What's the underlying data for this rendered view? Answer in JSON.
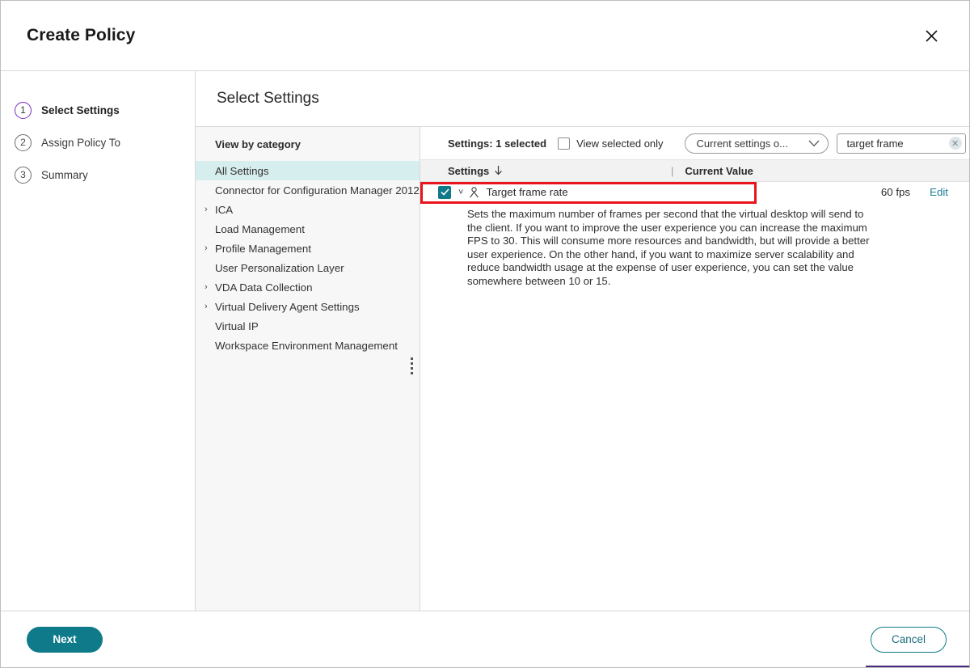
{
  "window": {
    "title": "Create Policy",
    "close_icon": "close-icon",
    "accent_teal": "#0f7b8a",
    "accent_purple": "#7b2fbe",
    "highlight_red": "#e8141e"
  },
  "steps": [
    {
      "num": "1",
      "label": "Select Settings",
      "active": true
    },
    {
      "num": "2",
      "label": "Assign Policy To",
      "active": false
    },
    {
      "num": "3",
      "label": "Summary",
      "active": false
    }
  ],
  "main": {
    "heading": "Select Settings"
  },
  "categories": {
    "title": "View by category",
    "items": [
      {
        "label": "All Settings",
        "expandable": false,
        "selected": true
      },
      {
        "label": "Connector for Configuration Manager 2012",
        "expandable": false,
        "selected": false
      },
      {
        "label": "ICA",
        "expandable": true,
        "selected": false
      },
      {
        "label": "Load Management",
        "expandable": false,
        "selected": false
      },
      {
        "label": "Profile Management",
        "expandable": true,
        "selected": false
      },
      {
        "label": "User Personalization Layer",
        "expandable": false,
        "selected": false
      },
      {
        "label": "VDA Data Collection",
        "expandable": true,
        "selected": false
      },
      {
        "label": "Virtual Delivery Agent Settings",
        "expandable": true,
        "selected": false
      },
      {
        "label": "Virtual IP",
        "expandable": false,
        "selected": false
      },
      {
        "label": "Workspace Environment Management",
        "expandable": false,
        "selected": false
      }
    ]
  },
  "toolbar": {
    "selected_count_label": "Settings: 1 selected",
    "view_selected_only_label": "View selected only",
    "view_selected_only_checked": false,
    "filter_dropdown_value": "Current settings o...",
    "filter_dropdown_icon": "chevron-down-icon",
    "search_value": "target frame",
    "search_placeholder": "Search",
    "search_clear_icon": "clear-icon"
  },
  "table": {
    "col_settings": "Settings",
    "col_sort_icon": "arrow-down-icon",
    "col_separator": "|",
    "col_current_value": "Current Value",
    "rows": [
      {
        "name": "Target frame rate",
        "value": "60 fps",
        "edit_label": "Edit",
        "checked": true,
        "expanded": true,
        "scope_icon": "user-icon",
        "description": "Sets the maximum number of frames per second that the virtual desktop will send to the client. If you want to improve the user experience you can increase the maximum FPS to 30. This will consume more resources and bandwidth, but will provide a better user experience. On the other hand, if you want to maximize server scalability and reduce bandwidth usage at the expense of user experience, you can set the value somewhere between 10 or 15."
      }
    ]
  },
  "footer": {
    "next_label": "Next",
    "cancel_label": "Cancel"
  }
}
